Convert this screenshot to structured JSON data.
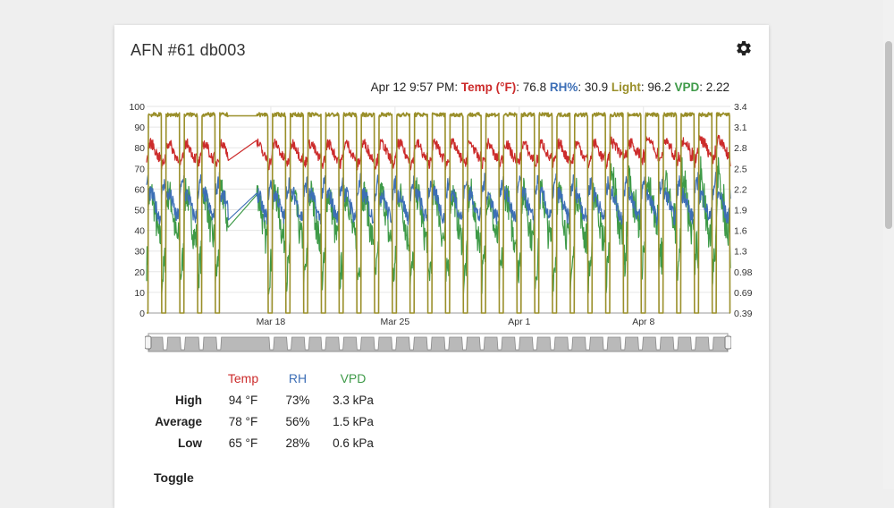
{
  "card": {
    "title": "AFN #61 db003"
  },
  "readout": {
    "timestamp": "Apr 12 9:57 PM:",
    "temp_label": "Temp (°F)",
    "temp_value": ": 76.8",
    "rh_label": "RH%",
    "rh_value": ": 30.9",
    "light_label": "Light",
    "light_value": ": 96.2",
    "vpd_label": "VPD",
    "vpd_value": ": 2.22"
  },
  "colors": {
    "temp": "#cc2b2b",
    "rh": "#3d6fb6",
    "light": "#9a8f2a",
    "vpd": "#3e9a48"
  },
  "chart_data": {
    "type": "line",
    "x_start": "Mar 11",
    "x_end": "Apr 12 9:57 PM",
    "x_ticks": [
      "Mar 18",
      "Mar 25",
      "Apr 1",
      "Apr 8"
    ],
    "y_left_ticks": [
      "0",
      "10",
      "20",
      "30",
      "40",
      "50",
      "60",
      "70",
      "80",
      "90",
      "100"
    ],
    "y_left_range": [
      0,
      100
    ],
    "y_right_ticks": [
      "0.39",
      "0.69",
      "0.98",
      "1.3",
      "1.6",
      "1.9",
      "2.2",
      "2.5",
      "2.8",
      "3.1",
      "3.4"
    ],
    "y_right_range": [
      0.39,
      3.4
    ],
    "grid": true,
    "gap": {
      "from_day": 4.6,
      "to_day": 6.2
    },
    "series": [
      {
        "name": "Temp (°F)",
        "axis": "left",
        "color": "#cc2b2b",
        "day_mean": 78.5,
        "night_mean": 74,
        "min": 65,
        "max": 94
      },
      {
        "name": "RH%",
        "axis": "left",
        "color": "#3d6fb6",
        "day_mean": 52,
        "night_mean": 62,
        "min": 28,
        "max": 73
      },
      {
        "name": "Light",
        "axis": "left",
        "color": "#9a8f2a",
        "on_value": 96,
        "off_value": 0
      },
      {
        "name": "VPD",
        "axis": "right",
        "color": "#3e9a48",
        "day_mean": 1.8,
        "night_mean": 1.1,
        "min": 0.6,
        "max": 3.3
      }
    ]
  },
  "stats": {
    "headers": [
      "Temp",
      "RH",
      "VPD"
    ],
    "rows": [
      {
        "label": "High",
        "temp": "94 °F",
        "rh": "73%",
        "vpd": "3.3 kPa"
      },
      {
        "label": "Average",
        "temp": "78 °F",
        "rh": "56%",
        "vpd": "1.5 kPa"
      },
      {
        "label": "Low",
        "temp": "65 °F",
        "rh": "28%",
        "vpd": "0.6 kPa"
      }
    ]
  },
  "toggle": {
    "label": "Toggle"
  }
}
